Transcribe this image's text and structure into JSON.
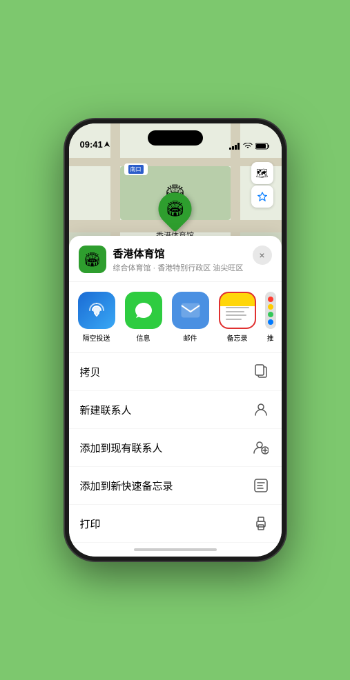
{
  "status_bar": {
    "time": "09:41",
    "location_arrow": true
  },
  "map": {
    "label": "南口",
    "controls": {
      "map_type": "🗺",
      "location": "↗"
    }
  },
  "pin": {
    "label": "香港体育馆"
  },
  "bottom_sheet": {
    "close_label": "×",
    "location_name": "香港体育馆",
    "location_desc": "综合体育馆 · 香港特别行政区 油尖旺区",
    "share_actions": [
      {
        "id": "airdrop",
        "label": "隔空投送",
        "emoji": "📡"
      },
      {
        "id": "messages",
        "label": "信息",
        "emoji": "💬"
      },
      {
        "id": "mail",
        "label": "邮件",
        "emoji": "✉️"
      },
      {
        "id": "notes",
        "label": "备忘录",
        "selected": true
      },
      {
        "id": "more",
        "label": "推",
        "is_more": true
      }
    ],
    "menu_items": [
      {
        "id": "copy",
        "label": "拷贝",
        "icon": "copy"
      },
      {
        "id": "new-contact",
        "label": "新建联系人",
        "icon": "person"
      },
      {
        "id": "add-contact",
        "label": "添加到现有联系人",
        "icon": "person-add"
      },
      {
        "id": "quick-note",
        "label": "添加到新快速备忘录",
        "icon": "note"
      },
      {
        "id": "print",
        "label": "打印",
        "icon": "print"
      }
    ]
  }
}
